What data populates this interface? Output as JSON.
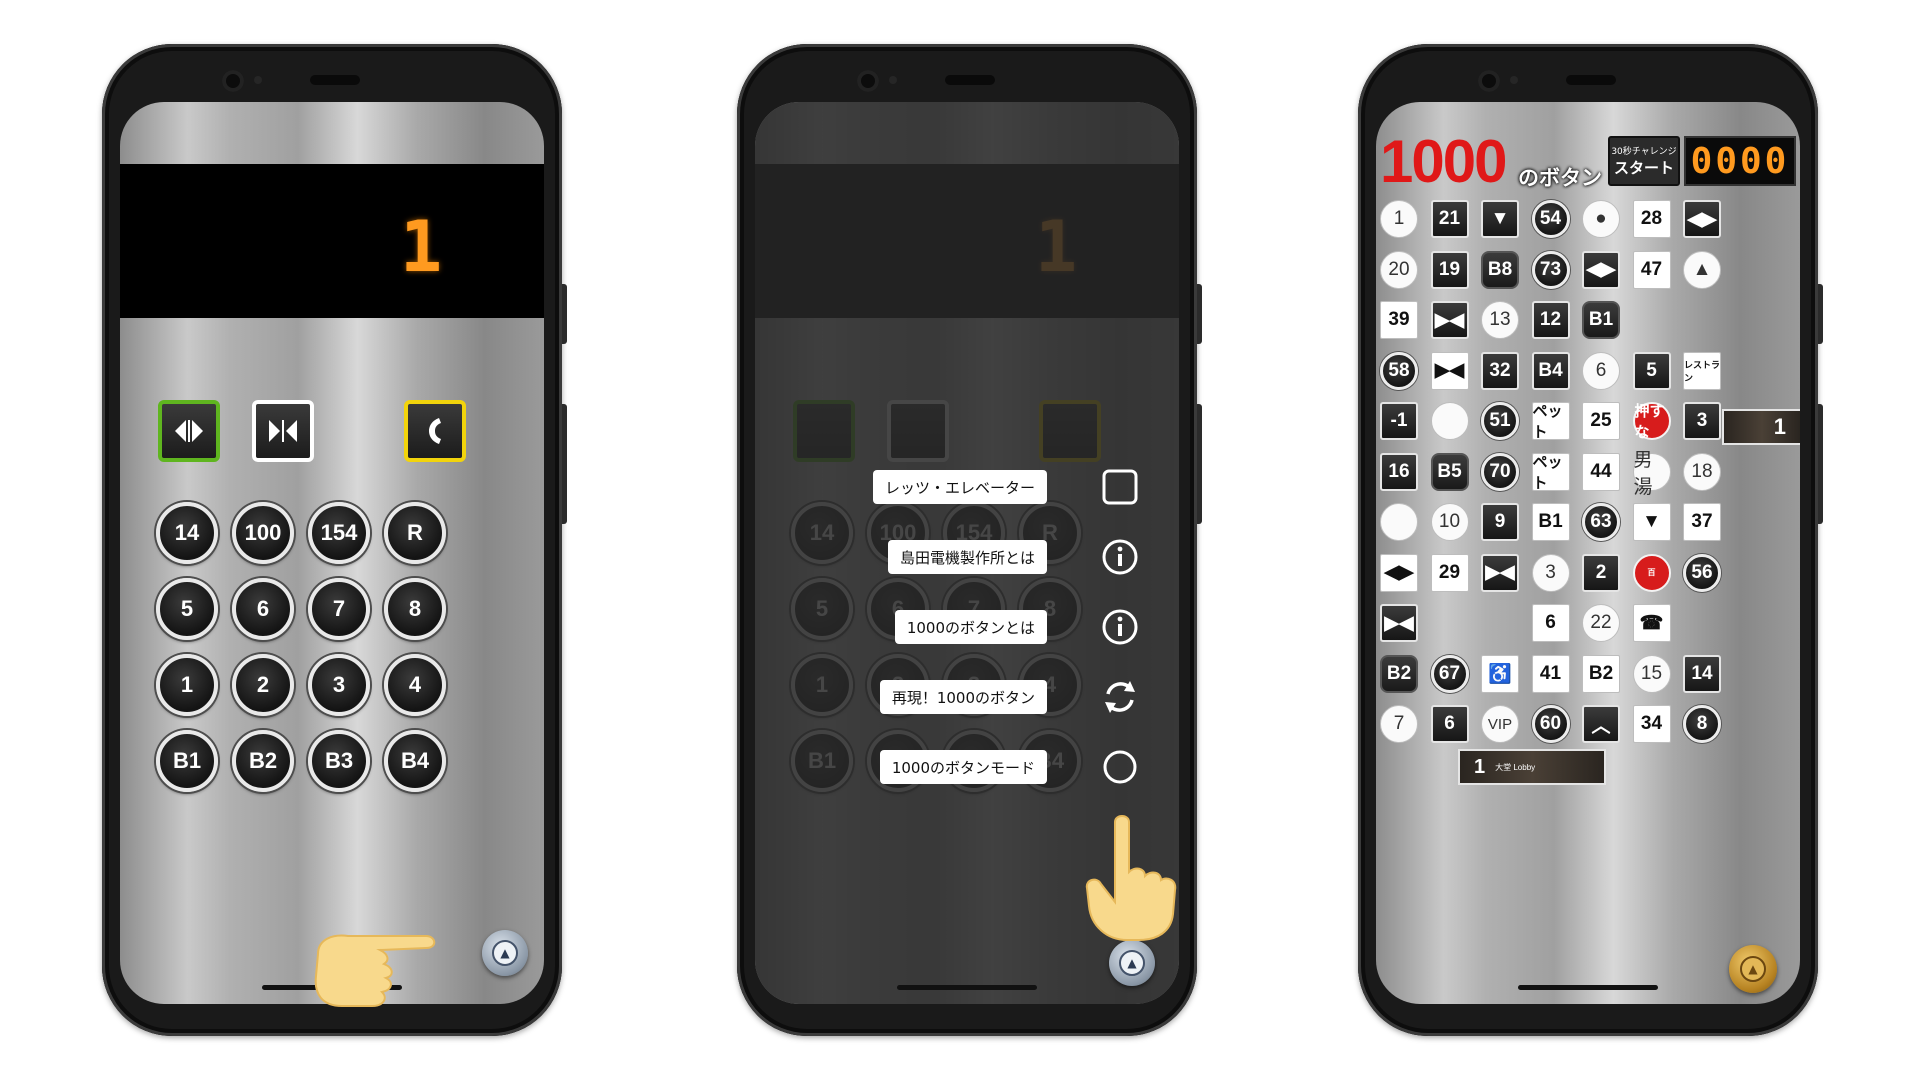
{
  "screens": [
    {
      "floor_display": "1",
      "top_buttons": [
        {
          "name": "door-open-button",
          "icon": "door-open-icon",
          "border": "#5fb51f"
        },
        {
          "name": "door-close-button",
          "icon": "door-close-icon",
          "border": "#ffffff"
        },
        {
          "name": "emergency-call-button",
          "icon": "phone-icon",
          "border": "#f2d40c"
        }
      ],
      "floor_buttons": [
        [
          "14",
          "100",
          "154",
          "R"
        ],
        [
          "5",
          "6",
          "7",
          "8"
        ],
        [
          "1",
          "2",
          "3",
          "4"
        ],
        [
          "B1",
          "B2",
          "B3",
          "B4"
        ]
      ]
    },
    {
      "menu_items": [
        {
          "label": "レッツ・エレベーター",
          "icon": "square-checkbox-icon"
        },
        {
          "label": "島田電機製作所とは",
          "icon": "info-icon"
        },
        {
          "label": "1000のボタンとは",
          "icon": "info-icon"
        },
        {
          "label": "再現！1000のボタン",
          "icon": "refresh-icon"
        },
        {
          "label": "1000のボタンモード",
          "icon": "mode-icon"
        }
      ]
    },
    {
      "title_number": "1000",
      "title_suffix": "のボタン",
      "challenge_small": "30秒チャレンジ",
      "challenge_big": "スタート",
      "counter": "0000",
      "wide_lobby_number": "1",
      "wide_lobby_text": "大堂 Lobby",
      "wide_number": "1",
      "grid": [
        [
          "1",
          "21",
          "▼",
          "54",
          "●",
          "28",
          "◀▶"
        ],
        [
          "20",
          "19",
          "B8",
          "73",
          "◀▶",
          "47",
          "▲"
        ],
        [
          "39",
          "▶◀",
          "13",
          "12",
          "B1",
          "",
          ""
        ],
        [
          "58",
          "▶◀",
          "32",
          "B4",
          "6",
          "5",
          "レストラン"
        ],
        [
          "-1",
          "",
          "51",
          "ペット",
          "25",
          "押すな",
          "3"
        ],
        [
          "16",
          "B5",
          "70",
          "ペット",
          "44",
          "男湯",
          "18"
        ],
        [
          "",
          "10",
          "9",
          "B1",
          "63",
          "▼",
          "37"
        ],
        [
          "◀▶",
          "29",
          "▶◀",
          "3",
          "2",
          "百",
          "56"
        ],
        [
          "▶◀",
          "",
          "",
          "6",
          "22",
          "☎",
          ""
        ],
        [
          "B2",
          "67",
          "♿",
          "41",
          "B2",
          "15",
          "14"
        ],
        [
          "7",
          "6",
          "VIP",
          "60",
          "︿",
          "34",
          "8"
        ]
      ]
    }
  ]
}
